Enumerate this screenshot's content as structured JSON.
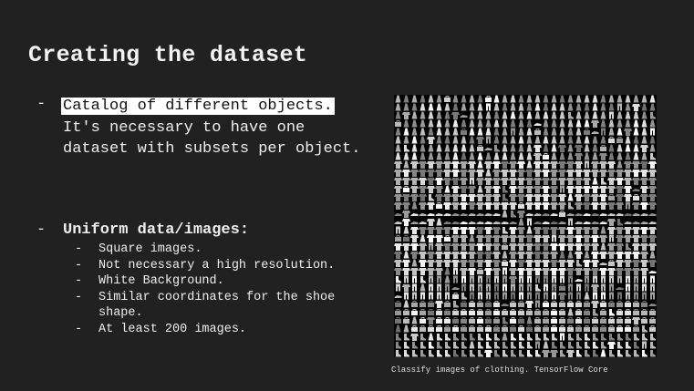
{
  "slide": {
    "title": "Creating the dataset",
    "bullet1": {
      "dash": "-",
      "highlight": "Catalog of different objects.",
      "rest": "It's necessary to have one dataset with subsets per object."
    },
    "bullet2": {
      "dash": "-",
      "heading": "Uniform data/images:",
      "subitems": [
        {
          "dash": "-",
          "text": "Square images."
        },
        {
          "dash": "-",
          "text": "Not necessary a high resolution."
        },
        {
          "dash": "-",
          "text": "White Background."
        },
        {
          "dash": "-",
          "text": "Similar coordinates for the shoe shape."
        },
        {
          "dash": "-",
          "text": "At least 200 images."
        }
      ]
    },
    "image": {
      "icon": "fashion-mnist-grid",
      "caption": "Classify images of clothing. TensorFlow Core"
    }
  },
  "colors": {
    "background": "#212121",
    "text": "#eeeeee",
    "highlight_bg": "#ffffff",
    "highlight_text": "#111111"
  }
}
